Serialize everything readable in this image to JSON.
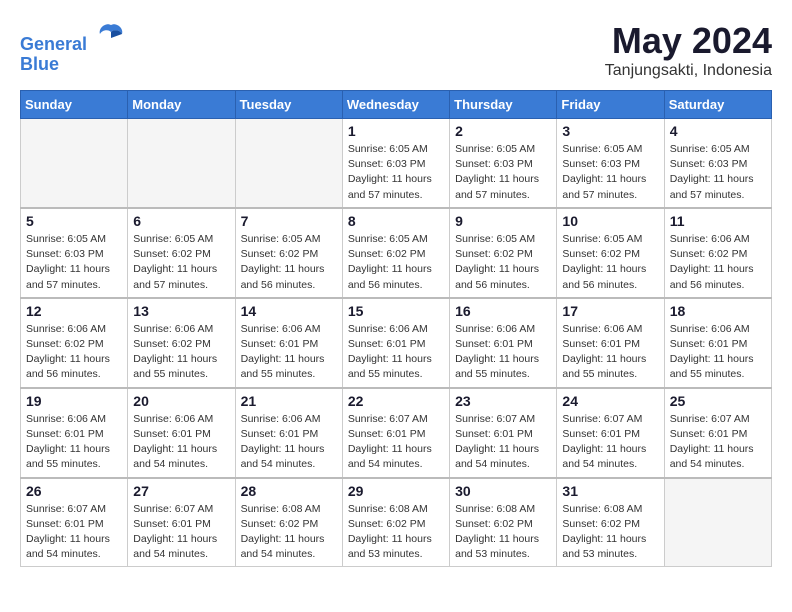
{
  "header": {
    "logo_line1": "General",
    "logo_line2": "Blue",
    "month": "May 2024",
    "location": "Tanjungsakti, Indonesia"
  },
  "weekdays": [
    "Sunday",
    "Monday",
    "Tuesday",
    "Wednesday",
    "Thursday",
    "Friday",
    "Saturday"
  ],
  "weeks": [
    [
      {
        "day": "",
        "empty": true
      },
      {
        "day": "",
        "empty": true
      },
      {
        "day": "",
        "empty": true
      },
      {
        "day": "1",
        "sunrise": "6:05 AM",
        "sunset": "6:03 PM",
        "daylight": "11 hours and 57 minutes."
      },
      {
        "day": "2",
        "sunrise": "6:05 AM",
        "sunset": "6:03 PM",
        "daylight": "11 hours and 57 minutes."
      },
      {
        "day": "3",
        "sunrise": "6:05 AM",
        "sunset": "6:03 PM",
        "daylight": "11 hours and 57 minutes."
      },
      {
        "day": "4",
        "sunrise": "6:05 AM",
        "sunset": "6:03 PM",
        "daylight": "11 hours and 57 minutes."
      }
    ],
    [
      {
        "day": "5",
        "sunrise": "6:05 AM",
        "sunset": "6:03 PM",
        "daylight": "11 hours and 57 minutes."
      },
      {
        "day": "6",
        "sunrise": "6:05 AM",
        "sunset": "6:02 PM",
        "daylight": "11 hours and 57 minutes."
      },
      {
        "day": "7",
        "sunrise": "6:05 AM",
        "sunset": "6:02 PM",
        "daylight": "11 hours and 56 minutes."
      },
      {
        "day": "8",
        "sunrise": "6:05 AM",
        "sunset": "6:02 PM",
        "daylight": "11 hours and 56 minutes."
      },
      {
        "day": "9",
        "sunrise": "6:05 AM",
        "sunset": "6:02 PM",
        "daylight": "11 hours and 56 minutes."
      },
      {
        "day": "10",
        "sunrise": "6:05 AM",
        "sunset": "6:02 PM",
        "daylight": "11 hours and 56 minutes."
      },
      {
        "day": "11",
        "sunrise": "6:06 AM",
        "sunset": "6:02 PM",
        "daylight": "11 hours and 56 minutes."
      }
    ],
    [
      {
        "day": "12",
        "sunrise": "6:06 AM",
        "sunset": "6:02 PM",
        "daylight": "11 hours and 56 minutes."
      },
      {
        "day": "13",
        "sunrise": "6:06 AM",
        "sunset": "6:02 PM",
        "daylight": "11 hours and 55 minutes."
      },
      {
        "day": "14",
        "sunrise": "6:06 AM",
        "sunset": "6:01 PM",
        "daylight": "11 hours and 55 minutes."
      },
      {
        "day": "15",
        "sunrise": "6:06 AM",
        "sunset": "6:01 PM",
        "daylight": "11 hours and 55 minutes."
      },
      {
        "day": "16",
        "sunrise": "6:06 AM",
        "sunset": "6:01 PM",
        "daylight": "11 hours and 55 minutes."
      },
      {
        "day": "17",
        "sunrise": "6:06 AM",
        "sunset": "6:01 PM",
        "daylight": "11 hours and 55 minutes."
      },
      {
        "day": "18",
        "sunrise": "6:06 AM",
        "sunset": "6:01 PM",
        "daylight": "11 hours and 55 minutes."
      }
    ],
    [
      {
        "day": "19",
        "sunrise": "6:06 AM",
        "sunset": "6:01 PM",
        "daylight": "11 hours and 55 minutes."
      },
      {
        "day": "20",
        "sunrise": "6:06 AM",
        "sunset": "6:01 PM",
        "daylight": "11 hours and 54 minutes."
      },
      {
        "day": "21",
        "sunrise": "6:06 AM",
        "sunset": "6:01 PM",
        "daylight": "11 hours and 54 minutes."
      },
      {
        "day": "22",
        "sunrise": "6:07 AM",
        "sunset": "6:01 PM",
        "daylight": "11 hours and 54 minutes."
      },
      {
        "day": "23",
        "sunrise": "6:07 AM",
        "sunset": "6:01 PM",
        "daylight": "11 hours and 54 minutes."
      },
      {
        "day": "24",
        "sunrise": "6:07 AM",
        "sunset": "6:01 PM",
        "daylight": "11 hours and 54 minutes."
      },
      {
        "day": "25",
        "sunrise": "6:07 AM",
        "sunset": "6:01 PM",
        "daylight": "11 hours and 54 minutes."
      }
    ],
    [
      {
        "day": "26",
        "sunrise": "6:07 AM",
        "sunset": "6:01 PM",
        "daylight": "11 hours and 54 minutes."
      },
      {
        "day": "27",
        "sunrise": "6:07 AM",
        "sunset": "6:01 PM",
        "daylight": "11 hours and 54 minutes."
      },
      {
        "day": "28",
        "sunrise": "6:08 AM",
        "sunset": "6:02 PM",
        "daylight": "11 hours and 54 minutes."
      },
      {
        "day": "29",
        "sunrise": "6:08 AM",
        "sunset": "6:02 PM",
        "daylight": "11 hours and 53 minutes."
      },
      {
        "day": "30",
        "sunrise": "6:08 AM",
        "sunset": "6:02 PM",
        "daylight": "11 hours and 53 minutes."
      },
      {
        "day": "31",
        "sunrise": "6:08 AM",
        "sunset": "6:02 PM",
        "daylight": "11 hours and 53 minutes."
      },
      {
        "day": "",
        "empty": true
      }
    ]
  ]
}
